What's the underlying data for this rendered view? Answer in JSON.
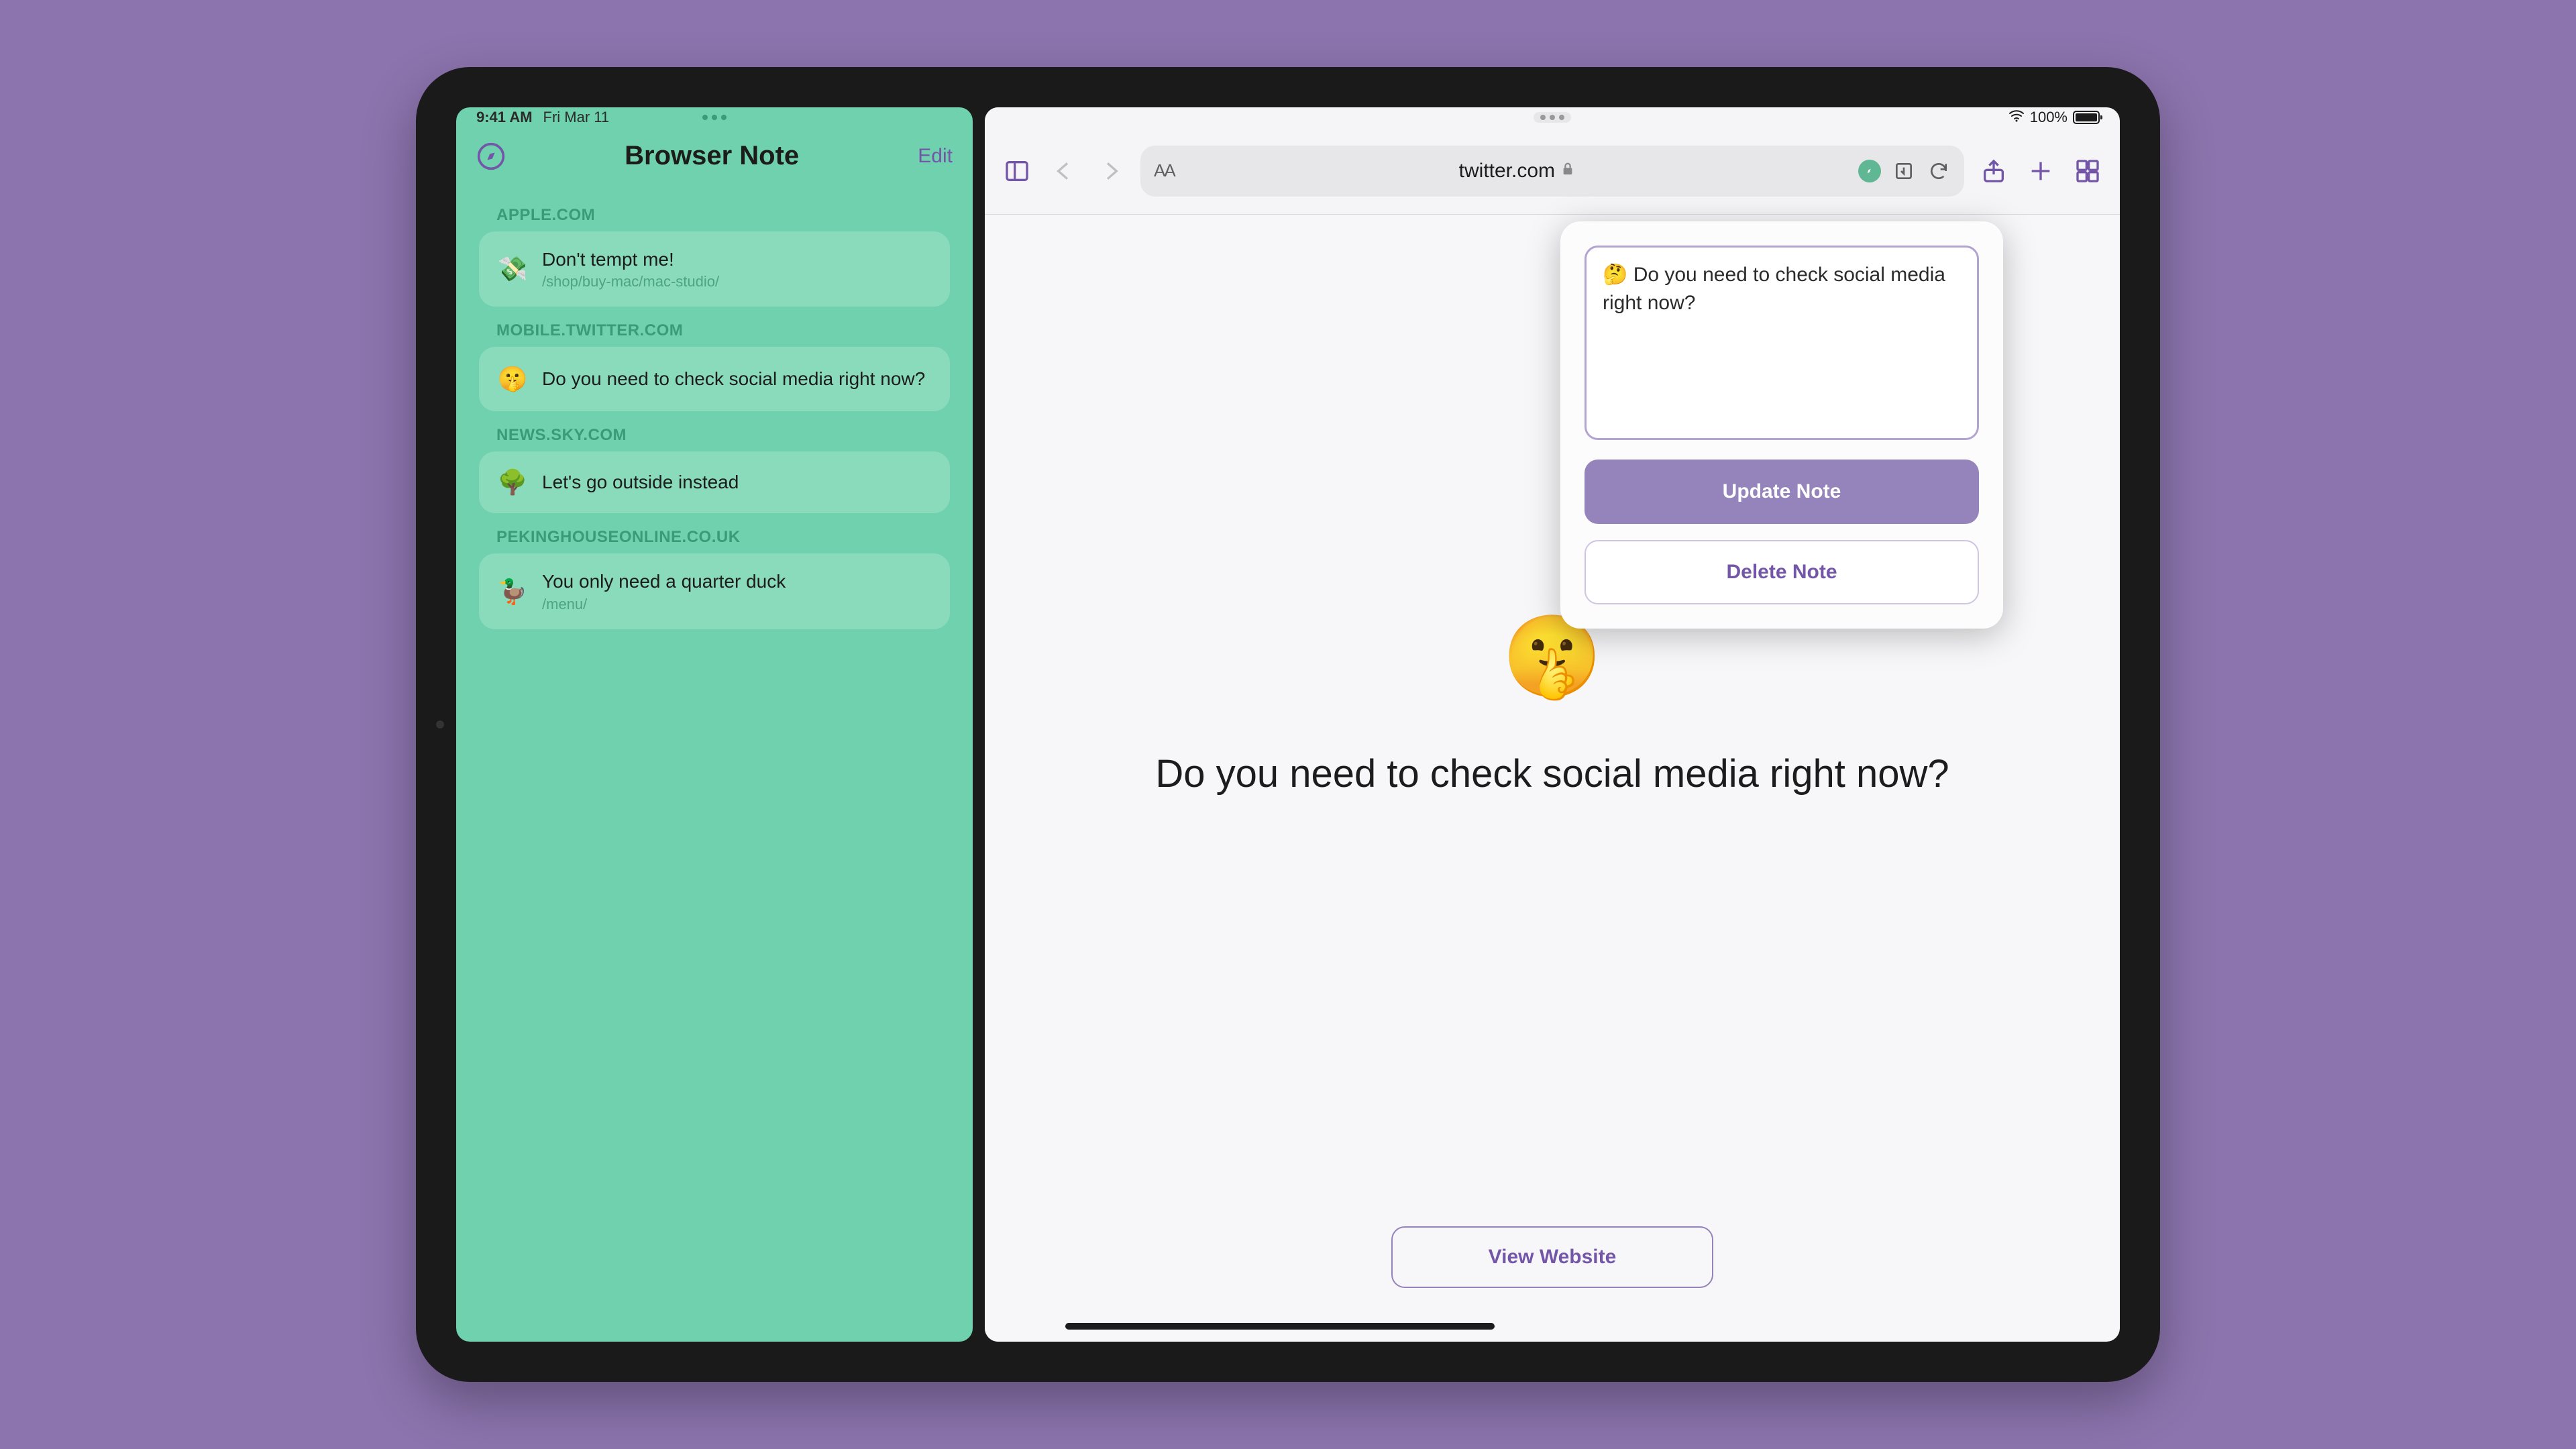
{
  "status_bar": {
    "time": "9:41 AM",
    "date": "Fri Mar 11",
    "battery": "100%"
  },
  "left_app": {
    "title": "Browser Note",
    "edit_label": "Edit",
    "sections": [
      {
        "domain": "APPLE.COM",
        "emoji": "💸",
        "title": "Don't tempt me!",
        "path": "/shop/buy-mac/mac-studio/"
      },
      {
        "domain": "MOBILE.TWITTER.COM",
        "emoji": "🤫",
        "title": "Do you need to check social media right now?",
        "path": ""
      },
      {
        "domain": "NEWS.SKY.COM",
        "emoji": "🌳",
        "title": "Let's go outside instead",
        "path": ""
      },
      {
        "domain": "PEKINGHOUSEONLINE.CO.UK",
        "emoji": "🦆",
        "title": "You only need a quarter duck",
        "path": "/menu/"
      }
    ]
  },
  "safari": {
    "url": "twitter.com",
    "content_emoji": "🤫",
    "content_text": "Do you need to check social media right now?",
    "view_website": "View Website"
  },
  "popover": {
    "text": "🤔 Do you need to check social media right now?",
    "update": "Update Note",
    "delete": "Delete Note"
  }
}
